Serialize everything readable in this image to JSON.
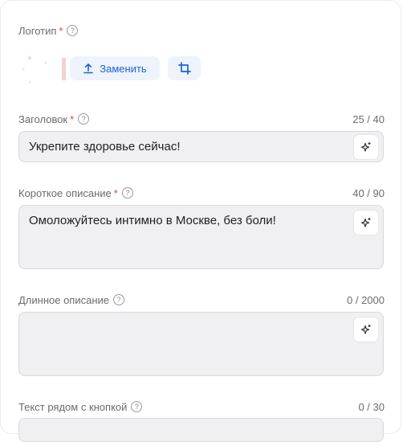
{
  "logo": {
    "label": "Логотип",
    "required_mark": "*",
    "help_glyph": "?",
    "replace_label": "Заменить",
    "icons": {
      "upload": "upload-icon",
      "crop": "crop-icon"
    }
  },
  "headline": {
    "label": "Заголовок",
    "required_mark": "*",
    "help_glyph": "?",
    "counter": "25 / 40",
    "value": "Укрепите здоровье сейчас!"
  },
  "short_description": {
    "label": "Короткое описание",
    "required_mark": "*",
    "help_glyph": "?",
    "counter": "40 / 90",
    "value": "Омоложуйтесь интимно в Москве, без боли!"
  },
  "long_description": {
    "label": "Длинное описание",
    "help_glyph": "?",
    "counter": "0 / 2000",
    "value": ""
  },
  "button_text": {
    "label": "Текст рядом с кнопкой",
    "help_glyph": "?",
    "counter": "0 / 30"
  },
  "colors": {
    "accent": "#1b63d6",
    "required": "#e8413c",
    "field_bg": "#f0f0f2"
  }
}
